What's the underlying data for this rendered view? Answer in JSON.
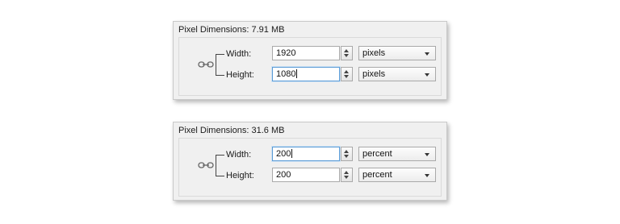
{
  "panels": [
    {
      "title": "Pixel Dimensions: 7.91 MB",
      "width": {
        "label": "Width:",
        "value": "1920",
        "unit": "pixels"
      },
      "height": {
        "label": "Height:",
        "value": "1080",
        "unit": "pixels"
      },
      "focused": "height",
      "link_icon": "chain-link-icon"
    },
    {
      "title": "Pixel Dimensions: 31.6 MB",
      "width": {
        "label": "Width:",
        "value": "200",
        "unit": "percent"
      },
      "height": {
        "label": "Height:",
        "value": "200",
        "unit": "percent"
      },
      "focused": "width",
      "link_icon": "chain-link-icon"
    }
  ],
  "colors": {
    "panel_bg": "#f0f0f0",
    "panel_border": "#c9c9c9",
    "focus_border": "#5b9bd5"
  }
}
